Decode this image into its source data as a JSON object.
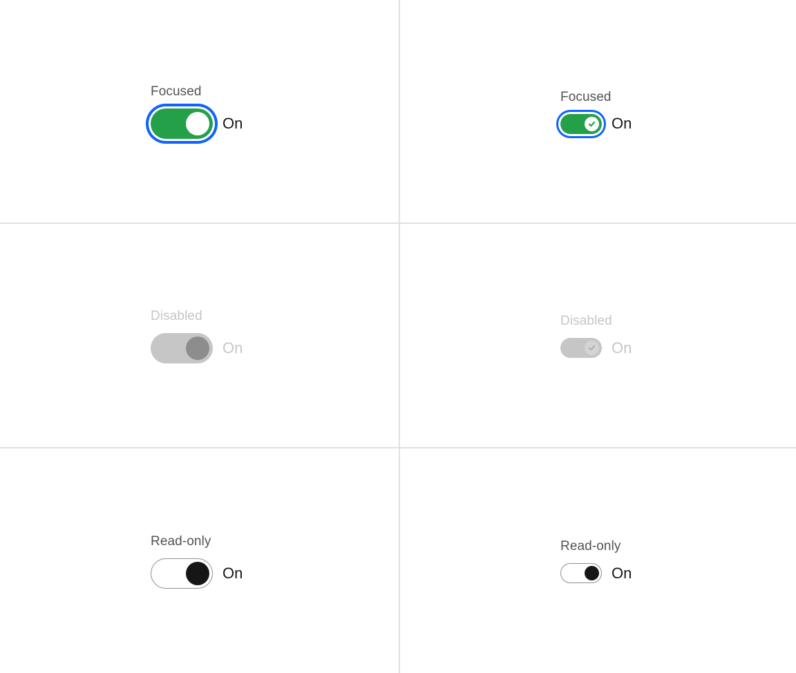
{
  "theme": {
    "accent_green": "#24a148",
    "focus_blue": "#0f62fe",
    "label_color": "#525252",
    "text_color": "#161616",
    "disabled_color": "#c6c6c6",
    "divider_color": "#e0e0e0",
    "knob_disabled_color": "#8d8d8d",
    "readonly_border_color": "#8d8d8d",
    "readonly_knob_color": "#161616"
  },
  "cells": [
    {
      "id": "focused-default",
      "label": "Focused",
      "state_text": "On",
      "size": "default",
      "state": "focused",
      "icon": "check-icon"
    },
    {
      "id": "focused-small",
      "label": "Focused",
      "state_text": "On",
      "size": "small",
      "state": "focused",
      "icon": "check-icon"
    },
    {
      "id": "disabled-default",
      "label": "Disabled",
      "state_text": "On",
      "size": "default",
      "state": "disabled",
      "icon": "check-icon"
    },
    {
      "id": "disabled-small",
      "label": "Disabled",
      "state_text": "On",
      "size": "small",
      "state": "disabled",
      "icon": "check-icon"
    },
    {
      "id": "readonly-default",
      "label": "Read-only",
      "state_text": "On",
      "size": "default",
      "state": "readonly",
      "icon": "check-icon"
    },
    {
      "id": "readonly-small",
      "label": "Read-only",
      "state_text": "On",
      "size": "small",
      "state": "readonly",
      "icon": "check-icon"
    }
  ]
}
